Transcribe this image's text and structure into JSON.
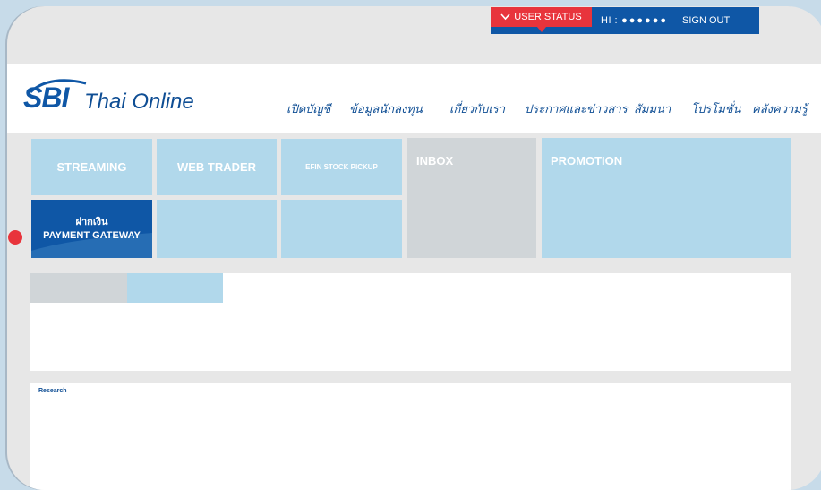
{
  "status_bar": {
    "user_status_label": "USER STATUS",
    "hi_label": "HI :",
    "masked_name": "●●●●●●",
    "sign_out_label": "SIGN OUT"
  },
  "header": {
    "logo_brand": "SBI",
    "logo_text": "Thai Online",
    "nav": [
      {
        "label": "เปิดบัญชี"
      },
      {
        "label": "ข้อมูลนักลงทุน"
      },
      {
        "label": "เกี่ยวกับเรา"
      },
      {
        "label": "ประกาศและข่าวสาร"
      },
      {
        "label": "สัมมนา"
      },
      {
        "label": "โปรโมชั่น"
      },
      {
        "label": "คลังความรู้"
      }
    ]
  },
  "tiles": {
    "streaming": "STREAMING",
    "web_trader": "WEB TRADER",
    "efin": "EFIN STOCK PICKUP",
    "inbox": "INBOX",
    "promotion": "PROMOTION",
    "deposit_th": "ฝากเงิน",
    "deposit_en": "PAYMENT GATEWAY"
  },
  "research": {
    "title": "Research"
  },
  "colors": {
    "brand_blue": "#0f57a6",
    "accent_red": "#e8343c",
    "tile_light_blue": "#b1d8eb",
    "tile_grey": "#d0d5d8"
  }
}
